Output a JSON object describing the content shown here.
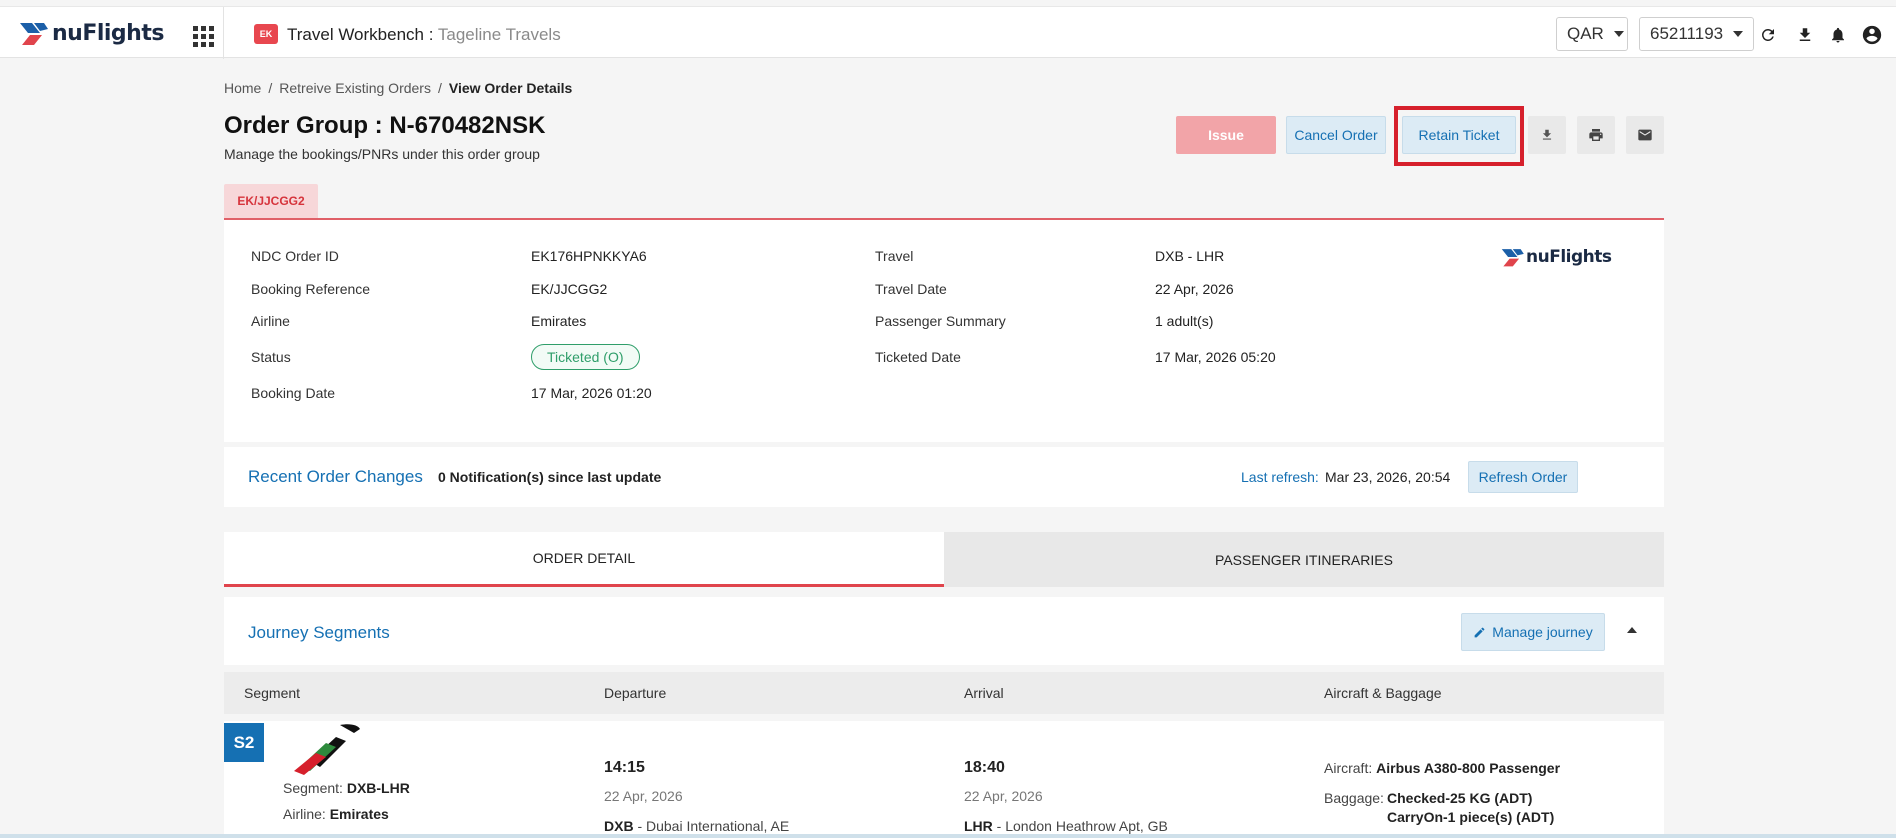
{
  "header": {
    "logo_text": "nuFlights",
    "app_badge": "EK",
    "app_title": "Travel Workbench : ",
    "app_subtitle": "Tageline Travels",
    "currency": "QAR",
    "account": "65211193"
  },
  "breadcrumb": {
    "home": "Home",
    "sep1": "/",
    "retrieve": "Retreive Existing Orders",
    "sep2": "/",
    "current": "View Order Details"
  },
  "page": {
    "title": "Order Group : N-670482NSK",
    "subtitle": "Manage the bookings/PNRs under this order group"
  },
  "actions": {
    "issue": "Issue",
    "cancel": "Cancel Order",
    "retain": "Retain Ticket"
  },
  "pnr_tab": "EK/JJCGG2",
  "details": {
    "ndc_order_id_label": "NDC Order ID",
    "ndc_order_id": "EK176HPNKKYA6",
    "booking_ref_label": "Booking Reference",
    "booking_ref": "EK/JJCGG2",
    "airline_label": "Airline",
    "airline": "Emirates",
    "status_label": "Status",
    "status": "Ticketed (O)",
    "booking_date_label": "Booking Date",
    "booking_date": "17 Mar, 2026 01:20",
    "travel_label": "Travel",
    "travel": "DXB - LHR",
    "travel_date_label": "Travel Date",
    "travel_date": "22 Apr, 2026",
    "pax_summary_label": "Passenger Summary",
    "pax_summary": "1 adult(s)",
    "ticketed_date_label": "Ticketed Date",
    "ticketed_date": "17 Mar, 2026 05:20",
    "logo_text": "nuFlights"
  },
  "recent": {
    "title": "Recent Order Changes",
    "notifications": "0 Notification(s) since last update",
    "last_refresh_label": "Last refresh:",
    "last_refresh": "Mar 23, 2026, 20:54",
    "refresh_button": "Refresh Order"
  },
  "tabs": {
    "order_detail": "ORDER DETAIL",
    "passenger_itineraries": "PASSENGER ITINERARIES"
  },
  "journey": {
    "title": "Journey Segments",
    "manage_button": "Manage journey",
    "columns": [
      "Segment",
      "Departure",
      "Arrival",
      "Aircraft & Baggage"
    ],
    "segment": {
      "badge": "S2",
      "segment_label": "Segment:",
      "segment_value": "DXB-LHR",
      "airline_label": "Airline:",
      "airline_value": "Emirates",
      "dep_time": "14:15",
      "dep_date": "22 Apr, 2026",
      "dep_code": "DXB",
      "dep_airport": " - Dubai International, AE",
      "arr_time": "18:40",
      "arr_date": "22 Apr, 2026",
      "arr_code": "LHR",
      "arr_airport": " - London Heathrow Apt, GB",
      "aircraft_label": "Aircraft:",
      "aircraft_value": "Airbus A380-800 Passenger",
      "baggage_label": "Baggage:",
      "baggage_checked": "Checked-25 KG (ADT)",
      "baggage_carryon": "CarryOn-1 piece(s) (ADT)"
    }
  },
  "colors": {
    "accent_blue": "#1570b3",
    "accent_red": "#e0444c",
    "status_green": "#2f9e6a"
  }
}
